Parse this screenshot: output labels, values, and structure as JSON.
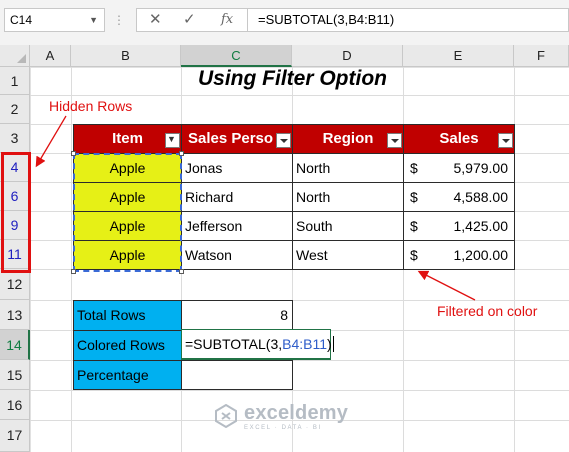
{
  "formula_bar": {
    "name_box": "C14",
    "cancel_icon": "✕",
    "enter_icon": "✓",
    "fx_icon": "fx",
    "formula": "=SUBTOTAL(3,B4:B11)"
  },
  "columns": [
    "A",
    "B",
    "C",
    "D",
    "E",
    "F"
  ],
  "rows": [
    "1",
    "2",
    "3",
    "4",
    "6",
    "9",
    "11",
    "12",
    "13",
    "14",
    "15",
    "16",
    "17"
  ],
  "title": "Using Filter Option",
  "table": {
    "headers": [
      "Item",
      "Sales Perso",
      "Region",
      "Sales"
    ],
    "rows": [
      {
        "item": "Apple",
        "person": "Jonas",
        "region": "North",
        "currency": "$",
        "amount": "5,979.00"
      },
      {
        "item": "Apple",
        "person": "Richard",
        "region": "North",
        "currency": "$",
        "amount": "4,588.00"
      },
      {
        "item": "Apple",
        "person": "Jefferson",
        "region": "South",
        "currency": "$",
        "amount": "1,425.00"
      },
      {
        "item": "Apple",
        "person": "Watson",
        "region": "West",
        "currency": "$",
        "amount": "1,200.00"
      }
    ]
  },
  "summary": {
    "total_rows_label": "Total Rows",
    "total_rows_value": "8",
    "colored_rows_label": "Colored Rows",
    "formula_prefix": "=SUBTOTAL(3,",
    "formula_ref": "B4:B11",
    "formula_suffix": ")",
    "percentage_label": "Percentage"
  },
  "annotations": {
    "hidden_rows": "Hidden Rows",
    "filtered_on_color": "Filtered on color"
  },
  "watermark": {
    "name": "exceldemy",
    "tagline": "EXCEL · DATA · BI"
  },
  "colors": {
    "header_red": "#c00000",
    "item_yellow": "#e6f016",
    "summary_blue": "#00b0f0",
    "annotation_red": "#e01010",
    "excel_green": "#217346"
  }
}
